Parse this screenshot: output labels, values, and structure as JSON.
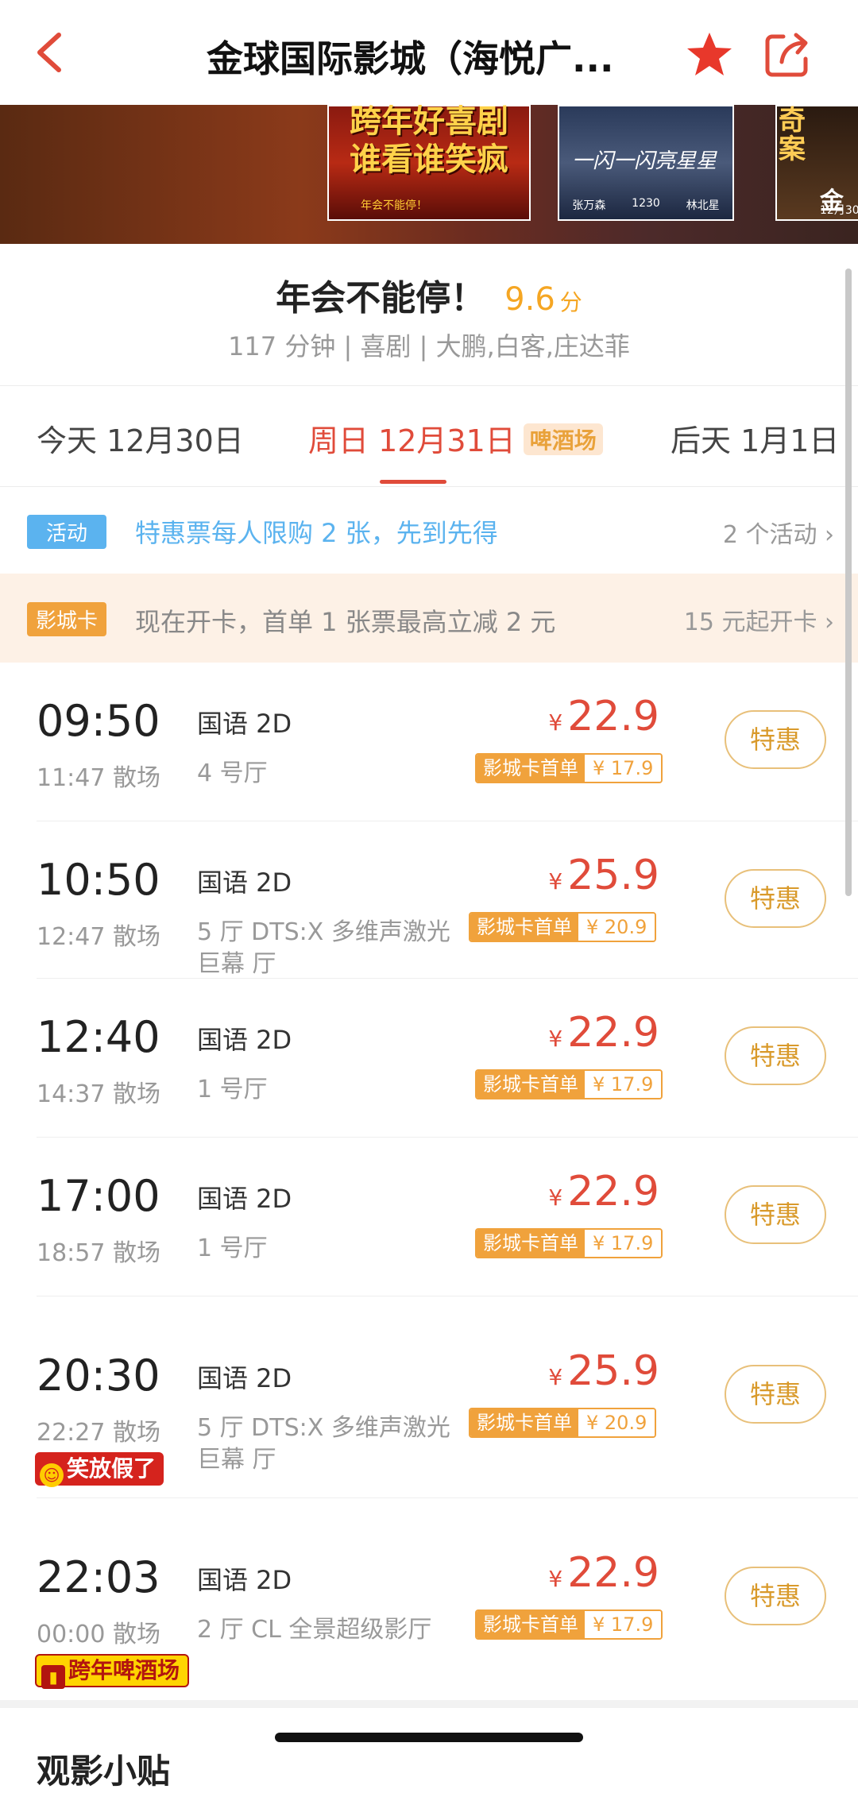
{
  "nav": {
    "title": "金球国际影城（海悦广...",
    "back_icon": "chevron-left-icon",
    "favorite_icon": "star-icon",
    "share_icon": "share-icon"
  },
  "posters": [
    {
      "line1": "跨年好喜剧",
      "line2": "谁看谁笑疯",
      "small": "年会不能停！"
    },
    {
      "title": "一闪一闪亮星星",
      "credits": [
        "张万森",
        "1230",
        "林北星"
      ]
    },
    {
      "line1": "奇",
      "line2": "案",
      "big": "金",
      "date": "12月30日"
    }
  ],
  "movie": {
    "name": "年会不能停！",
    "score": "9.6",
    "score_unit": "分",
    "meta": "117 分钟 | 喜剧 | 大鹏,白客,庄达菲"
  },
  "dates": {
    "tabs": [
      {
        "label": "今天 12月30日"
      },
      {
        "label": "周日 12月31日",
        "tag": "啤酒场"
      },
      {
        "label": "后天 1月1日"
      }
    ],
    "active_index": 1
  },
  "activity": {
    "chip": "活动",
    "text": "特惠票每人限购 2 张，先到先得",
    "link": "2 个活动"
  },
  "card": {
    "chip": "影城卡",
    "text": "现在开卡，首单 1 张票最高立减 2 元",
    "link": "15 元起开卡"
  },
  "showtimes": [
    {
      "start": "09:50",
      "end": "11:47 散场",
      "lang": "国语 2D",
      "hall": "4 号厅",
      "currency": "¥",
      "price": "22.9",
      "card_label": "影城卡首单",
      "card_price": "¥ 17.9",
      "button": "特惠"
    },
    {
      "start": "10:50",
      "end": "12:47 散场",
      "lang": "国语 2D",
      "hall": "5 厅 DTS:X 多维声激光巨幕 厅",
      "currency": "¥",
      "price": "25.9",
      "card_label": "影城卡首单",
      "card_price": "¥ 20.9",
      "button": "特惠"
    },
    {
      "start": "12:40",
      "end": "14:37 散场",
      "lang": "国语 2D",
      "hall": "1 号厅",
      "currency": "¥",
      "price": "22.9",
      "card_label": "影城卡首单",
      "card_price": "¥ 17.9",
      "button": "特惠"
    },
    {
      "start": "17:00",
      "end": "18:57 散场",
      "lang": "国语 2D",
      "hall": "1 号厅",
      "currency": "¥",
      "price": "22.9",
      "card_label": "影城卡首单",
      "card_price": "¥ 17.9",
      "button": "特惠"
    },
    {
      "start": "20:30",
      "end": "22:27 散场",
      "lang": "国语 2D",
      "hall": "5 厅 DTS:X 多维声激光巨幕 厅",
      "currency": "¥",
      "price": "25.9",
      "card_label": "影城卡首单",
      "card_price": "¥ 20.9",
      "button": "特惠",
      "badge": "笑放假了"
    },
    {
      "start": "22:03",
      "end": "00:00 散场",
      "lang": "国语 2D",
      "hall": "2 厅 CL 全景超级影厅",
      "currency": "¥",
      "price": "22.9",
      "card_label": "影城卡首单",
      "card_price": "¥ 17.9",
      "button": "特惠",
      "badge": "跨年啤酒场"
    }
  ],
  "bottom": {
    "title": "观影小贴"
  },
  "colors": {
    "accent": "#e04b3a",
    "gold": "#f0a23c",
    "blue": "#5bb3ef"
  }
}
